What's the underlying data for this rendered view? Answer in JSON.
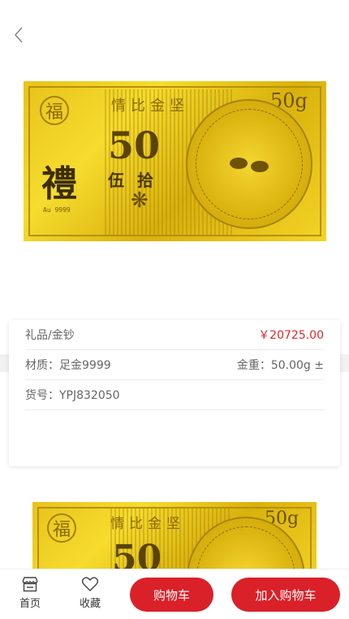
{
  "product_image": {
    "motto": "情比金坚",
    "weight_label": "50g",
    "big_number": "50",
    "li_char": "禮",
    "wushi": "伍拾",
    "purity": "Au 9999",
    "fu_char": "福"
  },
  "info": {
    "category": "礼品/金钞",
    "price": "￥20725.00",
    "material": "材质：足金9999",
    "gold_weight": "金重：50.00g ±",
    "sku": "货号：YPJ832050"
  },
  "bottom_bar": {
    "home_label": "首页",
    "favorite_label": "收藏",
    "cart_label": "购物车",
    "add_to_cart_label": "加入购物车"
  },
  "colors": {
    "accent": "#da2028",
    "price": "#e3262b",
    "gold": "#e8c21a"
  }
}
